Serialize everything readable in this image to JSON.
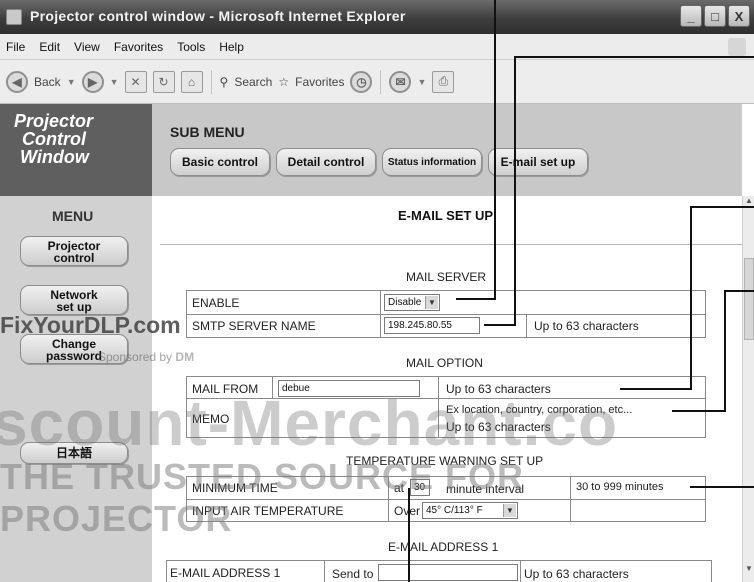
{
  "window": {
    "title": "Projector control window - Microsoft Internet Explorer",
    "buttons": [
      "_",
      "□",
      "X"
    ]
  },
  "menubar": {
    "items": [
      {
        "label": "File"
      },
      {
        "label": "Edit"
      },
      {
        "label": "View"
      },
      {
        "label": "Favorites"
      },
      {
        "label": "Tools"
      },
      {
        "label": "Help"
      }
    ]
  },
  "toolbar": {
    "back_label": "Back",
    "search_label": "Search",
    "favorites_label": "Favorites"
  },
  "brand": {
    "line1": "Projector",
    "line2": "Control",
    "line3": "Window"
  },
  "submenu": {
    "title": "SUB MENU",
    "buttons": [
      {
        "label": "Basic control"
      },
      {
        "label": "Detail control"
      },
      {
        "label": "Status information"
      },
      {
        "label": "E-mail set up"
      }
    ]
  },
  "sidebar": {
    "title": "MENU",
    "buttons": [
      {
        "line1": "Projector",
        "line2": "control"
      },
      {
        "line1": "Network",
        "line2": "set up"
      },
      {
        "line1": "Change",
        "line2": "password"
      },
      {
        "line1": "日本語",
        "line2": ""
      }
    ]
  },
  "content": {
    "page_title": "E-MAIL SET UP",
    "mail_server": {
      "title": "MAIL SERVER",
      "enable_label": "ENABLE",
      "enable_value": "Disable",
      "smtp_label": "SMTP SERVER NAME",
      "smtp_value": "198.245.80.55",
      "smtp_hint": "Up to 63 characters"
    },
    "mail_option": {
      "title": "MAIL OPTION",
      "from_label": "MAIL FROM",
      "from_value": "debue",
      "from_hint": "Up to 63 characters",
      "memo_label": "MEMO",
      "memo_hint_1": "Ex location, country, corporation, etc...",
      "memo_hint_2": "Up to 63 characters"
    },
    "temp_warning": {
      "title": "TEMPERATURE WARNING SET UP",
      "min_time_label": "MINIMUM TIME",
      "min_time_prefix": "at",
      "min_time_value": "30",
      "min_time_suffix": "minute interval",
      "min_time_range": "30 to 999 minutes",
      "air_temp_label": "INPUT AIR TEMPERATURE",
      "air_temp_prefix": "Over",
      "air_temp_value": "45° C/113° F"
    },
    "email_address_1": {
      "title": "E-MAIL ADDRESS 1",
      "label": "E-MAIL ADDRESS 1",
      "send_to": "Send to",
      "hint": "Up to 63 characters"
    }
  },
  "watermarks": {
    "site": "FixYourDLP.com",
    "sponsored": "Sponsored by",
    "sponsor_logo": "DM",
    "big": "scount-Merchant.co",
    "tagline": "THE TRUSTED SOURCE FOR PROJECTOR"
  }
}
